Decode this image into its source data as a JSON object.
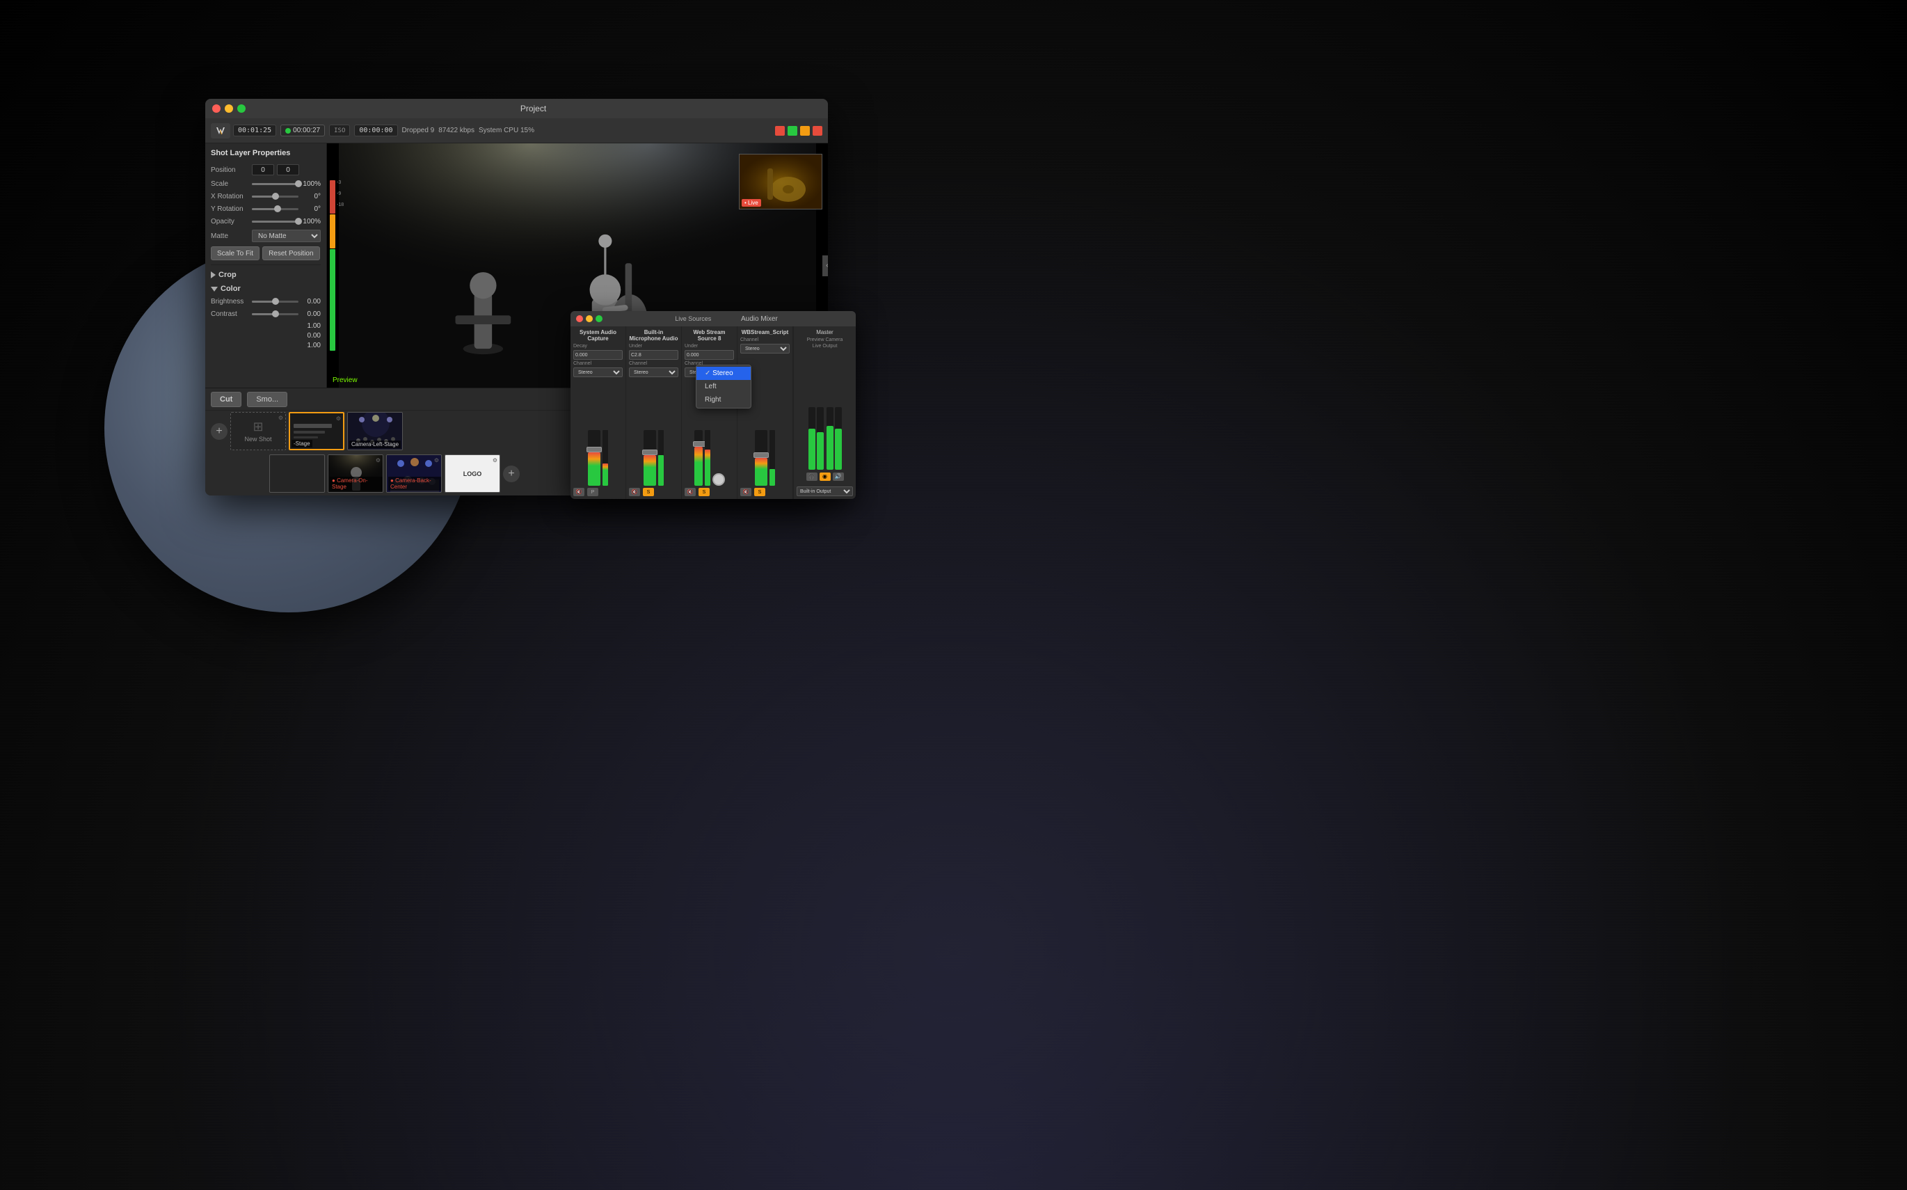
{
  "app": {
    "title": "Project",
    "logo_text": "Wirecast"
  },
  "window": {
    "title": "Project",
    "traffic_lights": [
      "red",
      "yellow",
      "green"
    ]
  },
  "toolbar": {
    "stream_time": "00:01:25",
    "record_time": "00:00:27",
    "stream_time2": "00:00:00",
    "dropped_label": "Dropped 9",
    "bitrate": "87422 kbps",
    "cpu": "System CPU 15%"
  },
  "shot_layer_properties": {
    "title": "Shot Layer Properties",
    "position_label": "Position",
    "position_x": "0",
    "position_y": "0",
    "scale_label": "Scale",
    "scale_value": "100%",
    "x_rotation_label": "X Rotation",
    "x_rotation_value": "0°",
    "y_rotation_label": "Y Rotation",
    "y_rotation_value": "0°",
    "opacity_label": "Opacity",
    "opacity_value": "100%",
    "matte_label": "Matte",
    "matte_value": "No Matte",
    "scale_to_fit_label": "Scale To Fit",
    "reset_position_label": "Reset Position",
    "crop_label": "Crop",
    "color_label": "Color",
    "brightness_label": "Brightness",
    "brightness_value": "0.00",
    "contrast_label": "Contrast",
    "contrast_value": "0.00",
    "extra_values": [
      "1.00",
      "0.00",
      "1.00"
    ]
  },
  "preview": {
    "label": "Preview"
  },
  "switcher": {
    "cut_label": "Cut",
    "smooth_label": "Smo...",
    "shots": [
      {
        "name": "New Shot",
        "type": "new",
        "style": "new-shot"
      },
      {
        "name": "-Stage",
        "type": "back-stage",
        "style": "thumb-stage-bw"
      },
      {
        "name": "Camera-Left-Stage",
        "type": "camera",
        "style": "thumb-crowd"
      },
      {
        "name": "Camera-On-Stage",
        "type": "camera-live",
        "style": "thumb-stage-bw",
        "live": true
      },
      {
        "name": "Camera-Back-Center",
        "type": "camera",
        "style": "thumb-crowd"
      },
      {
        "name": "Logo",
        "type": "logo",
        "style": "thumb-white"
      }
    ],
    "add_label": "+"
  },
  "audio_mixer": {
    "title": "Audio Mixer",
    "channels": [
      {
        "name": "System Audio Capture",
        "decay_label": "Decay",
        "decay_value": "0.000",
        "channel_label": "Channel",
        "channel_value": "Stereo"
      },
      {
        "name": "Built-in Microphone Audio",
        "under_label": "Under",
        "under_value": "C2.8",
        "channel_label": "Channel",
        "channel_value": "Stereo"
      },
      {
        "name": "Web Stream Source 8",
        "under_label": "Under",
        "under_value": "0.000",
        "channel_label": "Channel",
        "channel_value": "Stereo"
      },
      {
        "name": "WBStream_Script",
        "channel_label": "Channel",
        "channel_value": "Stereo"
      }
    ],
    "master": {
      "label": "Master",
      "preview_label": "Preview Camera",
      "live_label": "Live Output"
    },
    "dropdown": {
      "items": [
        "Stereo",
        "Left",
        "Right"
      ],
      "selected": "Stereo"
    }
  }
}
